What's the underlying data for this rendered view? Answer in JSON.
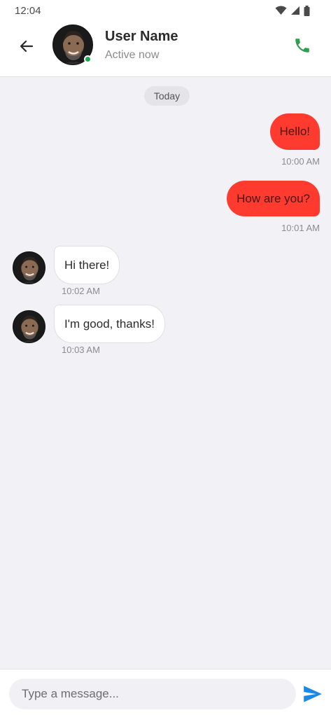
{
  "status_bar": {
    "time": "12:04",
    "icons": [
      "wifi-icon",
      "signal-icon",
      "battery-icon"
    ]
  },
  "header": {
    "back_icon": "arrow-left-icon",
    "contact_name": "User Name",
    "contact_status": "Active now",
    "call_icon": "phone-icon"
  },
  "chat": {
    "date_label": "Today",
    "messages": [
      {
        "direction": "outgoing",
        "text": "Hello!",
        "time": "10:00 AM"
      },
      {
        "direction": "outgoing",
        "text": "How are you?",
        "time": "10:01 AM"
      },
      {
        "direction": "incoming",
        "text": "Hi there!",
        "time": "10:02 AM"
      },
      {
        "direction": "incoming",
        "text": "I'm good, thanks!",
        "time": "10:03 AM"
      }
    ]
  },
  "composer": {
    "placeholder": "Type a message...",
    "value": "",
    "send_icon": "send-icon"
  },
  "colors": {
    "accent_outgoing": "#ff3b30",
    "online": "#1fa84f",
    "call": "#2e9e4f",
    "send": "#1e88e5",
    "chat_background": "#f2f1f6"
  }
}
